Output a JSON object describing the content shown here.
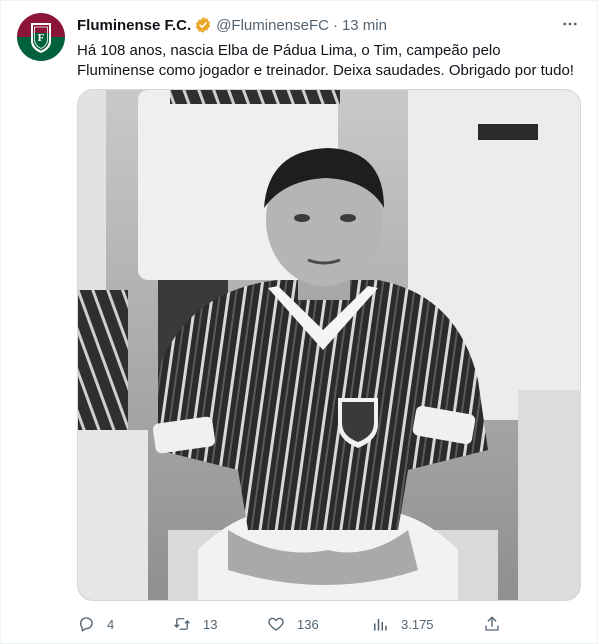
{
  "tweet": {
    "author_name": "Fluminense F.C.",
    "handle": "@FluminenseFC",
    "separator": "·",
    "time": "13 min",
    "text": "Há 108 anos, nascia Elba de Pádua Lima, o Tim, campeão pelo Fluminense como jogador e treinador. Deixa saudades. Obrigado por tudo!",
    "verified_badge_color": "#e8a82c",
    "media": {
      "description_icon": "photo",
      "crest_letters": "FFC"
    }
  },
  "actions": {
    "replies": "4",
    "retweets": "13",
    "likes": "136",
    "views": "3.175"
  },
  "colors": {
    "club_maroon": "#8a1538",
    "club_green": "#00613c",
    "secondary_text": "#536471"
  }
}
